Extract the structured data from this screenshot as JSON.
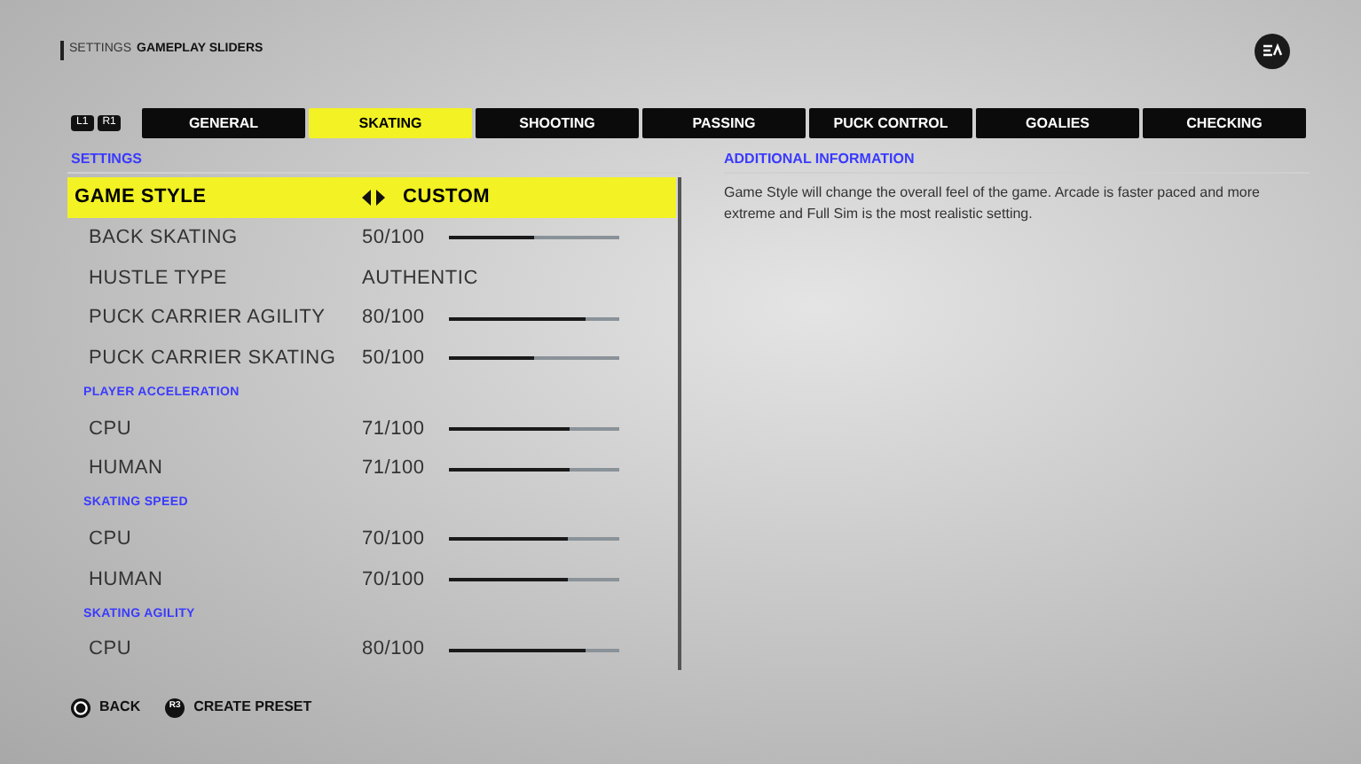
{
  "breadcrumb": {
    "section": "SETTINGS",
    "page": "GAMEPLAY SLIDERS"
  },
  "bumpers": [
    "L1",
    "R1"
  ],
  "tabs": [
    {
      "label": "GENERAL",
      "selected": false
    },
    {
      "label": "SKATING",
      "selected": true
    },
    {
      "label": "SHOOTING",
      "selected": false
    },
    {
      "label": "PASSING",
      "selected": false
    },
    {
      "label": "PUCK CONTROL",
      "selected": false
    },
    {
      "label": "GOALIES",
      "selected": false
    },
    {
      "label": "CHECKING",
      "selected": false
    }
  ],
  "settings": {
    "title": "SETTINGS",
    "rows": [
      {
        "kind": "selector",
        "label": "GAME STYLE",
        "value": "CUSTOM",
        "selected": true
      },
      {
        "kind": "slider",
        "label": "BACK SKATING",
        "value": "50/100",
        "level": 0.5,
        "selected": false
      },
      {
        "kind": "value",
        "label": "HUSTLE TYPE",
        "value": "AUTHENTIC",
        "selected": false
      },
      {
        "kind": "slider",
        "label": "PUCK CARRIER AGILITY",
        "value": "80/100",
        "level": 0.8,
        "selected": false
      },
      {
        "kind": "slider",
        "label": "PUCK CARRIER SKATING",
        "value": "50/100",
        "level": 0.5,
        "selected": false
      },
      {
        "kind": "heading",
        "label": "PLAYER ACCELERATION"
      },
      {
        "kind": "slider",
        "label": "CPU",
        "value": "71/100",
        "level": 0.71,
        "selected": false
      },
      {
        "kind": "slider",
        "label": "HUMAN",
        "value": "71/100",
        "level": 0.71,
        "selected": false
      },
      {
        "kind": "heading",
        "label": "SKATING SPEED"
      },
      {
        "kind": "slider",
        "label": "CPU",
        "value": "70/100",
        "level": 0.7,
        "selected": false
      },
      {
        "kind": "slider",
        "label": "HUMAN",
        "value": "70/100",
        "level": 0.7,
        "selected": false
      },
      {
        "kind": "heading",
        "label": "SKATING AGILITY"
      },
      {
        "kind": "slider",
        "label": "CPU",
        "value": "80/100",
        "level": 0.8,
        "selected": false
      }
    ]
  },
  "info": {
    "title": "ADDITIONAL INFORMATION",
    "text": "Game Style will change the overall feel of the game. Arcade is faster paced and more extreme and Full Sim is the most realistic setting."
  },
  "footer": [
    {
      "kind": "circle",
      "label": "BACK"
    },
    {
      "kind": "r3",
      "label": "CREATE PRESET",
      "key": "R3"
    }
  ]
}
